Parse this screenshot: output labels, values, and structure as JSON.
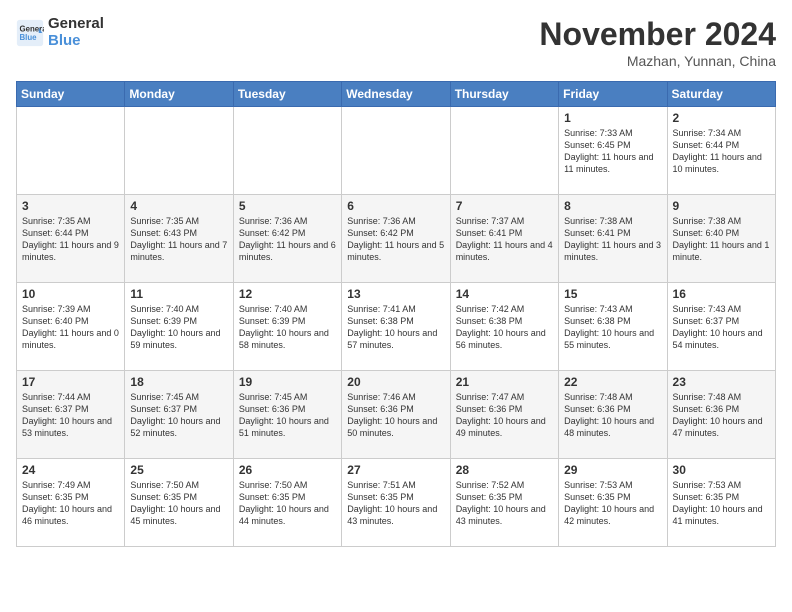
{
  "logo": {
    "general": "General",
    "blue": "Blue"
  },
  "header": {
    "month": "November 2024",
    "location": "Mazhan, Yunnan, China"
  },
  "days_of_week": [
    "Sunday",
    "Monday",
    "Tuesday",
    "Wednesday",
    "Thursday",
    "Friday",
    "Saturday"
  ],
  "weeks": [
    [
      {
        "day": "",
        "info": ""
      },
      {
        "day": "",
        "info": ""
      },
      {
        "day": "",
        "info": ""
      },
      {
        "day": "",
        "info": ""
      },
      {
        "day": "",
        "info": ""
      },
      {
        "day": "1",
        "info": "Sunrise: 7:33 AM\nSunset: 6:45 PM\nDaylight: 11 hours and 11 minutes."
      },
      {
        "day": "2",
        "info": "Sunrise: 7:34 AM\nSunset: 6:44 PM\nDaylight: 11 hours and 10 minutes."
      }
    ],
    [
      {
        "day": "3",
        "info": "Sunrise: 7:35 AM\nSunset: 6:44 PM\nDaylight: 11 hours and 9 minutes."
      },
      {
        "day": "4",
        "info": "Sunrise: 7:35 AM\nSunset: 6:43 PM\nDaylight: 11 hours and 7 minutes."
      },
      {
        "day": "5",
        "info": "Sunrise: 7:36 AM\nSunset: 6:42 PM\nDaylight: 11 hours and 6 minutes."
      },
      {
        "day": "6",
        "info": "Sunrise: 7:36 AM\nSunset: 6:42 PM\nDaylight: 11 hours and 5 minutes."
      },
      {
        "day": "7",
        "info": "Sunrise: 7:37 AM\nSunset: 6:41 PM\nDaylight: 11 hours and 4 minutes."
      },
      {
        "day": "8",
        "info": "Sunrise: 7:38 AM\nSunset: 6:41 PM\nDaylight: 11 hours and 3 minutes."
      },
      {
        "day": "9",
        "info": "Sunrise: 7:38 AM\nSunset: 6:40 PM\nDaylight: 11 hours and 1 minute."
      }
    ],
    [
      {
        "day": "10",
        "info": "Sunrise: 7:39 AM\nSunset: 6:40 PM\nDaylight: 11 hours and 0 minutes."
      },
      {
        "day": "11",
        "info": "Sunrise: 7:40 AM\nSunset: 6:39 PM\nDaylight: 10 hours and 59 minutes."
      },
      {
        "day": "12",
        "info": "Sunrise: 7:40 AM\nSunset: 6:39 PM\nDaylight: 10 hours and 58 minutes."
      },
      {
        "day": "13",
        "info": "Sunrise: 7:41 AM\nSunset: 6:38 PM\nDaylight: 10 hours and 57 minutes."
      },
      {
        "day": "14",
        "info": "Sunrise: 7:42 AM\nSunset: 6:38 PM\nDaylight: 10 hours and 56 minutes."
      },
      {
        "day": "15",
        "info": "Sunrise: 7:43 AM\nSunset: 6:38 PM\nDaylight: 10 hours and 55 minutes."
      },
      {
        "day": "16",
        "info": "Sunrise: 7:43 AM\nSunset: 6:37 PM\nDaylight: 10 hours and 54 minutes."
      }
    ],
    [
      {
        "day": "17",
        "info": "Sunrise: 7:44 AM\nSunset: 6:37 PM\nDaylight: 10 hours and 53 minutes."
      },
      {
        "day": "18",
        "info": "Sunrise: 7:45 AM\nSunset: 6:37 PM\nDaylight: 10 hours and 52 minutes."
      },
      {
        "day": "19",
        "info": "Sunrise: 7:45 AM\nSunset: 6:36 PM\nDaylight: 10 hours and 51 minutes."
      },
      {
        "day": "20",
        "info": "Sunrise: 7:46 AM\nSunset: 6:36 PM\nDaylight: 10 hours and 50 minutes."
      },
      {
        "day": "21",
        "info": "Sunrise: 7:47 AM\nSunset: 6:36 PM\nDaylight: 10 hours and 49 minutes."
      },
      {
        "day": "22",
        "info": "Sunrise: 7:48 AM\nSunset: 6:36 PM\nDaylight: 10 hours and 48 minutes."
      },
      {
        "day": "23",
        "info": "Sunrise: 7:48 AM\nSunset: 6:36 PM\nDaylight: 10 hours and 47 minutes."
      }
    ],
    [
      {
        "day": "24",
        "info": "Sunrise: 7:49 AM\nSunset: 6:35 PM\nDaylight: 10 hours and 46 minutes."
      },
      {
        "day": "25",
        "info": "Sunrise: 7:50 AM\nSunset: 6:35 PM\nDaylight: 10 hours and 45 minutes."
      },
      {
        "day": "26",
        "info": "Sunrise: 7:50 AM\nSunset: 6:35 PM\nDaylight: 10 hours and 44 minutes."
      },
      {
        "day": "27",
        "info": "Sunrise: 7:51 AM\nSunset: 6:35 PM\nDaylight: 10 hours and 43 minutes."
      },
      {
        "day": "28",
        "info": "Sunrise: 7:52 AM\nSunset: 6:35 PM\nDaylight: 10 hours and 43 minutes."
      },
      {
        "day": "29",
        "info": "Sunrise: 7:53 AM\nSunset: 6:35 PM\nDaylight: 10 hours and 42 minutes."
      },
      {
        "day": "30",
        "info": "Sunrise: 7:53 AM\nSunset: 6:35 PM\nDaylight: 10 hours and 41 minutes."
      }
    ]
  ]
}
